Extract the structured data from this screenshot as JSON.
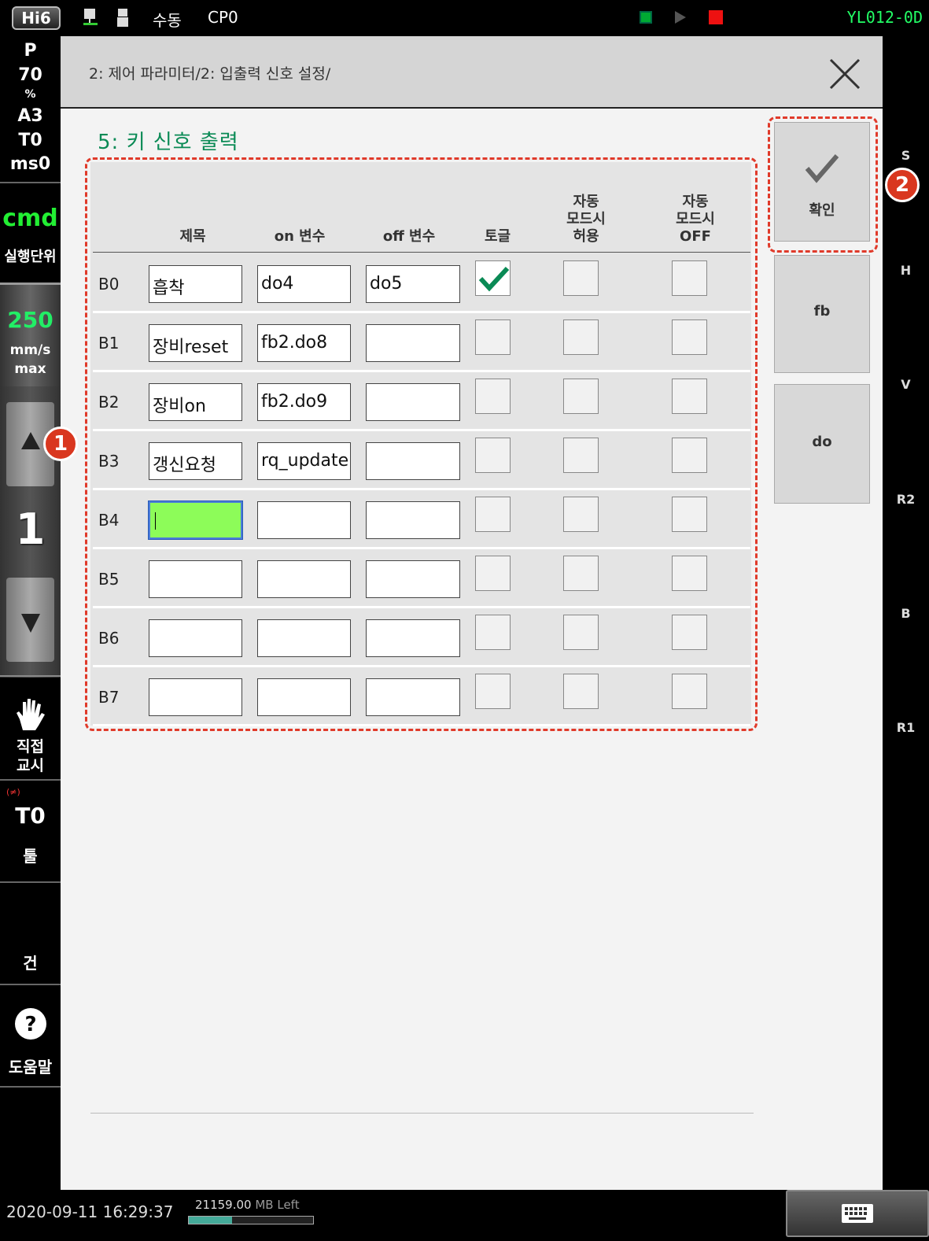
{
  "status_bar": {
    "logo": "Hi6",
    "mode": "수동",
    "program": "CP0",
    "robot_id": "YL012-0D"
  },
  "left_panel": {
    "p_label": "P",
    "speed_pct": "70",
    "pct_symbol": "%",
    "a_value": "A3",
    "t_value": "T0",
    "ms_value": "ms0",
    "cmd": "cmd",
    "exec_unit": "실행단위",
    "speed_value": "250",
    "speed_unit": "mm/s",
    "speed_max": "max",
    "step_value": "1",
    "direct_teach_line1": "직접",
    "direct_teach_line2": "교시",
    "tool_warn": "(≠)",
    "tool_value": "T0",
    "tool_label": "툴",
    "gun_label": "건",
    "help_label": "도움말"
  },
  "right_strip": [
    "S",
    "H",
    "V",
    "R2",
    "B",
    "R1"
  ],
  "header": {
    "breadcrumb": "2: 제어 파라미터/2: 입출력 신호 설정/"
  },
  "section_title": "5: 키 신호 출력",
  "table": {
    "col_title": "제목",
    "col_on": "on 변수",
    "col_off": "off 변수",
    "col_toggle": "토글",
    "col_auto_allow": [
      "자동",
      "모드시",
      "허용"
    ],
    "col_auto_off": [
      "자동",
      "모드시",
      "OFF"
    ],
    "rows": [
      {
        "label": "B0",
        "title": "흡착",
        "on": "do4",
        "off": "do5",
        "toggle": true,
        "auto_allow": false,
        "auto_off": false
      },
      {
        "label": "B1",
        "title": "장비reset",
        "on": "fb2.do8",
        "off": "",
        "toggle": false,
        "auto_allow": false,
        "auto_off": false
      },
      {
        "label": "B2",
        "title": "장비on",
        "on": "fb2.do9",
        "off": "",
        "toggle": false,
        "auto_allow": false,
        "auto_off": false
      },
      {
        "label": "B3",
        "title": "갱신요청",
        "on": "rq_update",
        "off": "",
        "toggle": false,
        "auto_allow": false,
        "auto_off": false
      },
      {
        "label": "B4",
        "title": "",
        "on": "",
        "off": "",
        "toggle": false,
        "auto_allow": false,
        "auto_off": false
      },
      {
        "label": "B5",
        "title": "",
        "on": "",
        "off": "",
        "toggle": false,
        "auto_allow": false,
        "auto_off": false
      },
      {
        "label": "B6",
        "title": "",
        "on": "",
        "off": "",
        "toggle": false,
        "auto_allow": false,
        "auto_off": false
      },
      {
        "label": "B7",
        "title": "",
        "on": "",
        "off": "",
        "toggle": false,
        "auto_allow": false,
        "auto_off": false
      }
    ]
  },
  "side_buttons": {
    "confirm": "확인",
    "fb": "fb",
    "do": "do"
  },
  "annotations": [
    "1",
    "2"
  ],
  "footer": {
    "datetime": "2020-09-11 16:29:37",
    "mb_value": "21159.00",
    "mb_unit": "MB Left",
    "mb_fraction": 0.35
  },
  "colors": {
    "accent_green": "#0a8a55",
    "active_field": "#8dfc59",
    "annotation_red": "#e03a2a"
  }
}
